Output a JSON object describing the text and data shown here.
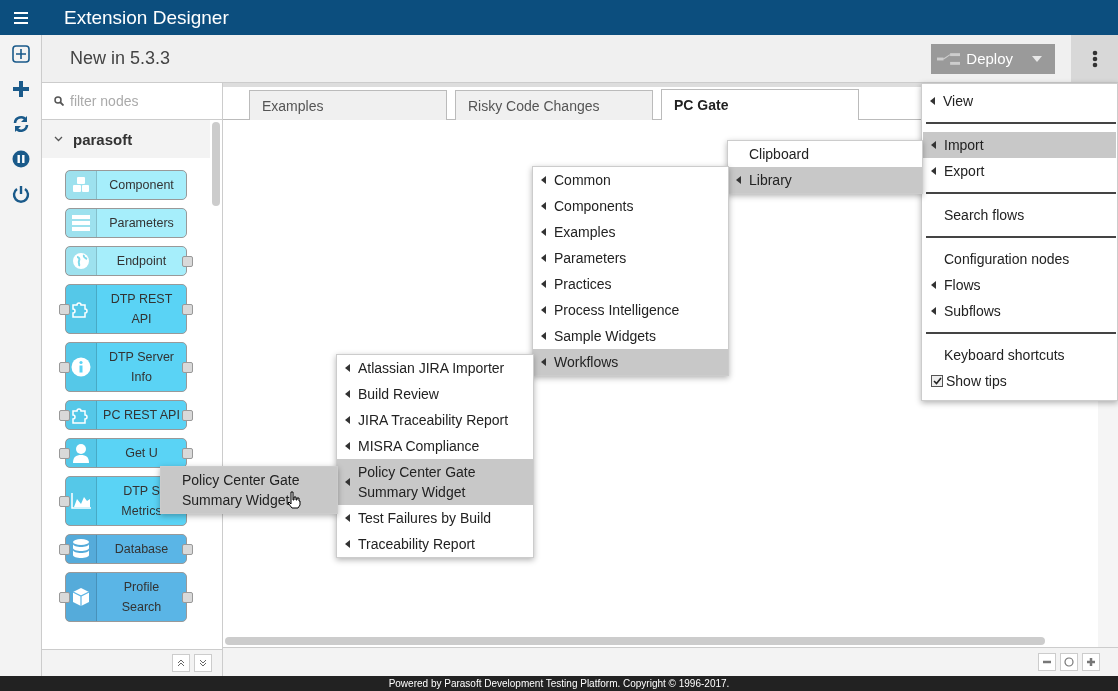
{
  "header": {
    "title": "Extension Designer"
  },
  "toolbar": {
    "title": "New in 5.3.3",
    "deploy": {
      "label": "Deploy",
      "disabled": true
    }
  },
  "palette": {
    "placeholder": "filter nodes",
    "category": {
      "label": "parasoft",
      "expanded": true
    },
    "nodes": [
      {
        "lines": [
          "Component"
        ],
        "kind": "cubes",
        "color": "#a6eefb",
        "input": false,
        "output": false
      },
      {
        "lines": [
          "Parameters"
        ],
        "kind": "list",
        "color": "#a6eefb",
        "input": false,
        "output": false
      },
      {
        "lines": [
          "Endpoint"
        ],
        "kind": "globe",
        "color": "#a6eefb",
        "input": false,
        "output": true
      },
      {
        "lines": [
          "DTP REST",
          "API"
        ],
        "kind": "puzzle",
        "color": "#5ad3f5",
        "input": true,
        "output": true
      },
      {
        "lines": [
          "DTP Server",
          "Info"
        ],
        "kind": "info",
        "color": "#5ad3f5",
        "input": true,
        "output": true
      },
      {
        "lines": [
          "PC REST API"
        ],
        "kind": "puzzle",
        "color": "#5ad3f5",
        "input": true,
        "output": true
      },
      {
        "lines": [
          "Get U"
        ],
        "kind": "user",
        "color": "#5ad3f5",
        "input": true,
        "output": true
      },
      {
        "lines": [
          "DTP S",
          "Metrics"
        ],
        "kind": "chart",
        "color": "#5ad3f5",
        "input": true,
        "output": false
      },
      {
        "lines": [
          "Database"
        ],
        "kind": "database",
        "color": "#5ab5e6",
        "input": true,
        "output": true
      },
      {
        "lines": [
          "Profile",
          "Search"
        ],
        "kind": "box",
        "color": "#5ab5e6",
        "input": true,
        "output": true
      }
    ]
  },
  "tabs": [
    {
      "label": "Examples",
      "selected": false
    },
    {
      "label": "Risky Code Changes",
      "selected": false
    },
    {
      "label": "PC Gate",
      "selected": true
    }
  ],
  "main_menu": [
    [
      {
        "label": "View",
        "submenu": true,
        "selected": false
      }
    ],
    [
      {
        "label": "Import",
        "submenu": true,
        "selected": true
      },
      {
        "label": "Export",
        "submenu": true,
        "selected": false
      }
    ],
    [
      {
        "label": "Search flows",
        "submenu": false,
        "selected": false
      }
    ],
    [
      {
        "label": "Configuration nodes",
        "submenu": false,
        "selected": false
      },
      {
        "label": "Flows",
        "submenu": true,
        "selected": false
      },
      {
        "label": "Subflows",
        "submenu": true,
        "selected": false
      }
    ],
    [
      {
        "label": "Keyboard shortcuts",
        "submenu": false,
        "selected": false
      },
      {
        "label": "Show tips",
        "submenu": false,
        "selected": false,
        "checked": true
      }
    ]
  ],
  "import_menu": [
    {
      "label": "Clipboard",
      "submenu": false,
      "selected": false
    },
    {
      "label": "Library",
      "submenu": true,
      "selected": true
    }
  ],
  "library_menu": [
    {
      "label": "Common",
      "submenu": true,
      "selected": false
    },
    {
      "label": "Components",
      "submenu": true,
      "selected": false
    },
    {
      "label": "Examples",
      "submenu": true,
      "selected": false
    },
    {
      "label": "Parameters",
      "submenu": true,
      "selected": false
    },
    {
      "label": "Practices",
      "submenu": true,
      "selected": false
    },
    {
      "label": "Process Intelligence",
      "submenu": true,
      "selected": false
    },
    {
      "label": "Sample Widgets",
      "submenu": true,
      "selected": false
    },
    {
      "label": "Workflows",
      "submenu": true,
      "selected": true
    }
  ],
  "workflows_menu": [
    {
      "label": "Atlassian JIRA Importer",
      "submenu": true,
      "selected": false
    },
    {
      "label": "Build Review",
      "submenu": true,
      "selected": false
    },
    {
      "label": "JIRA Traceability Report",
      "submenu": true,
      "selected": false
    },
    {
      "label": "MISRA Compliance",
      "submenu": true,
      "selected": false
    },
    {
      "label": "Policy Center Gate\nSummary Widget",
      "submenu": true,
      "selected": true
    },
    {
      "label": "Test Failures by Build",
      "submenu": true,
      "selected": false
    },
    {
      "label": "Traceability Report",
      "submenu": true,
      "selected": false
    }
  ],
  "policy_menu": [
    {
      "label": "Policy Center Gate\nSummary Widget",
      "submenu": false,
      "selected": true
    }
  ],
  "footer": "Powered by Parasoft Development Testing Platform. Copyright © 1996-2017."
}
